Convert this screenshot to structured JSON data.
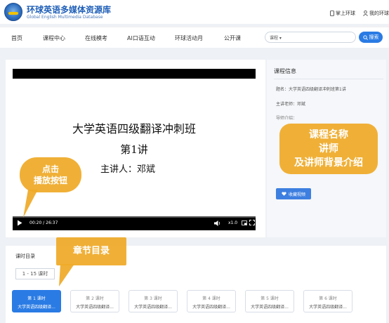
{
  "header": {
    "logo_title": "环球英语多媒体资源库",
    "logo_subtitle": "Global English Multimedia Database",
    "mobile_link": "掌上环球",
    "user_link": "我的环球"
  },
  "nav": {
    "items": [
      "首页",
      "课程中心",
      "在线模考",
      "AI口语互动",
      "环球活动月",
      "公开课"
    ],
    "search_select": "课程",
    "search_button": "搜索"
  },
  "video": {
    "line1": "大学英语四级翻译冲刺班",
    "line2": "第1讲",
    "line3": "主讲人：邓斌",
    "time": "00:20 / 26:37",
    "speed": "x1.0"
  },
  "info": {
    "heading": "课程信息",
    "title_row": "题名：大学英语四级翻译冲刺班第1讲",
    "teacher_row": "主讲老师：邓斌",
    "intro_prefix": "导师介绍：",
    "fav_button": "收藏视频"
  },
  "callouts": {
    "play": [
      "点击",
      "播放按钮"
    ],
    "info": [
      "课程名称",
      "讲师",
      "及讲师背景介绍"
    ],
    "chapters": "章节目录"
  },
  "lessons": {
    "title": "课时目录",
    "range_tab": "1 - 15 课时",
    "items": [
      {
        "num": "第 1 课时",
        "name": "大学英语四级翻译..."
      },
      {
        "num": "第 2 课时",
        "name": "大学英语四级翻译..."
      },
      {
        "num": "第 3 课时",
        "name": "大学英语四级翻译..."
      },
      {
        "num": "第 4 课时",
        "name": "大学英语四级翻译..."
      },
      {
        "num": "第 5 课时",
        "name": "大学英语四级翻译..."
      },
      {
        "num": "第 6 课时",
        "name": "大学英语四级翻译..."
      }
    ]
  },
  "colors": {
    "accent": "#2a7be4",
    "callout": "#efaa28"
  }
}
